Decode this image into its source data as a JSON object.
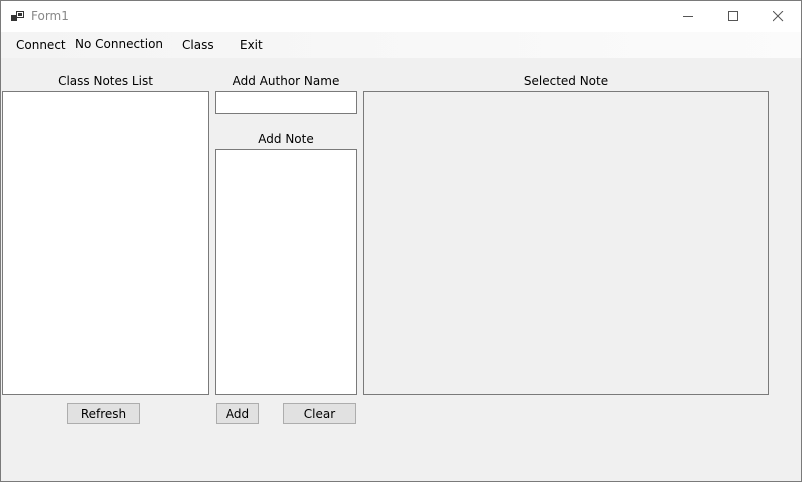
{
  "window": {
    "title": "Form1",
    "icon": "app-icon",
    "controls": [
      "minimize-icon",
      "maximize-icon",
      "close-icon"
    ]
  },
  "menu": {
    "connect": "Connect",
    "status": "No Connection",
    "class": "Class",
    "exit": "Exit"
  },
  "panels": {
    "class_notes_list_label": "Class Notes List",
    "add_author_name_label": "Add Author Name",
    "add_note_label": "Add Note",
    "selected_note_label": "Selected Note"
  },
  "inputs": {
    "author_name_value": "",
    "note_value": "",
    "selected_note_value": ""
  },
  "buttons": {
    "refresh": "Refresh",
    "add": "Add",
    "clear": "Clear"
  }
}
